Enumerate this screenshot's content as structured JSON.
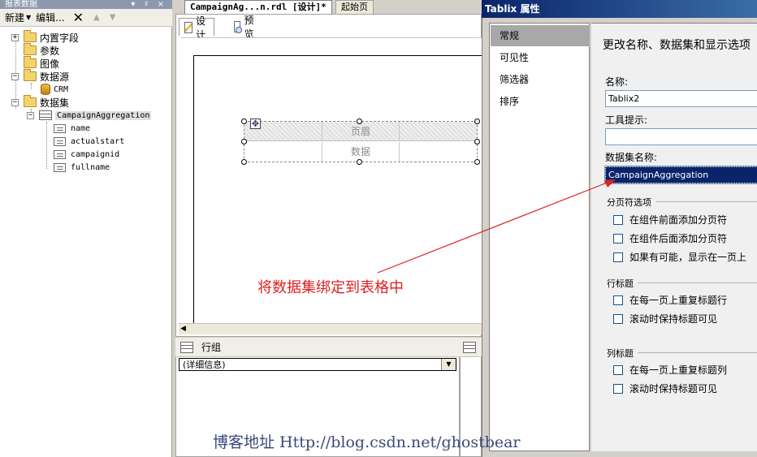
{
  "left_pane": {
    "title": "报表数据",
    "title_controls": "▾ ♯ ×",
    "toolbar": {
      "new_label": "新建",
      "edit_label": "编辑..."
    },
    "tree": {
      "builtin_fields": "内置字段",
      "parameters": "参数",
      "images": "图像",
      "datasources": "数据源",
      "datasource_item": "CRM",
      "datasets": "数据集",
      "dataset_item": "CampaignAggregation",
      "fields": [
        "name",
        "actualstart",
        "campaignid",
        "fullname"
      ]
    }
  },
  "designer": {
    "doc_tab": "CampaignAg...n.rdl [设计]*",
    "start_tab": "起始页",
    "view_tabs": {
      "design": "设计",
      "preview": "预览"
    },
    "tablix": {
      "header_cell": "页眉",
      "data_cell": "数据"
    },
    "row_groups": {
      "title": "行组",
      "details": "(详细信息)"
    }
  },
  "dialog": {
    "title": "Tablix 属性",
    "nav": [
      "常规",
      "可见性",
      "筛选器",
      "排序"
    ],
    "heading": "更改名称、数据集和显示选项",
    "name_label": "名称:",
    "name_value": "Tablix2",
    "tooltip_label": "工具提示:",
    "tooltip_value": "",
    "dataset_label": "数据集名称:",
    "dataset_value": "CampaignAggregation",
    "page_break_section": "分页符选项",
    "page_break_options": [
      "在组件前面添加分页符",
      "在组件后面添加分页符",
      "如果有可能，显示在一页上"
    ],
    "row_header_section": "行标题",
    "row_header_options": [
      "在每一页上重复标题行",
      "滚动时保持标题可见"
    ],
    "col_header_section": "列标题",
    "col_header_options": [
      "在每一页上重复标题列",
      "滚动时保持标题可见"
    ]
  },
  "annotation": "将数据集绑定到表格中",
  "watermark": "博客地址 Http://blog.csdn.net/ghostbear",
  "colors": {
    "annotation": "#e02020",
    "selection": "#0a246a"
  }
}
